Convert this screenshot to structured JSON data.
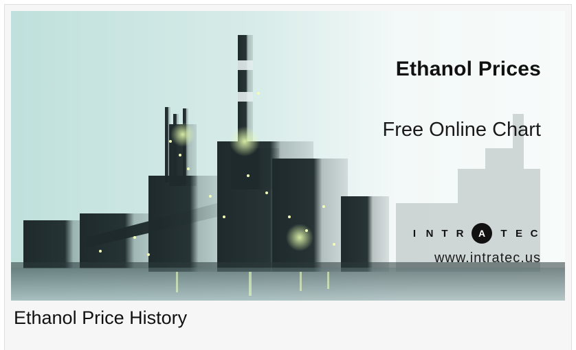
{
  "banner": {
    "title": "Ethanol Prices",
    "subtitle": "Free Online Chart",
    "brand_letters": [
      "I",
      "N",
      "T",
      "R",
      "A",
      "T",
      "E",
      "C"
    ],
    "brand_highlight": "A",
    "url": "www.intratec.us",
    "image": "industrial-plant-photo"
  },
  "heading": "Ethanol Price History",
  "colors": {
    "accent": "#111111",
    "background": "#f6f6f6"
  }
}
